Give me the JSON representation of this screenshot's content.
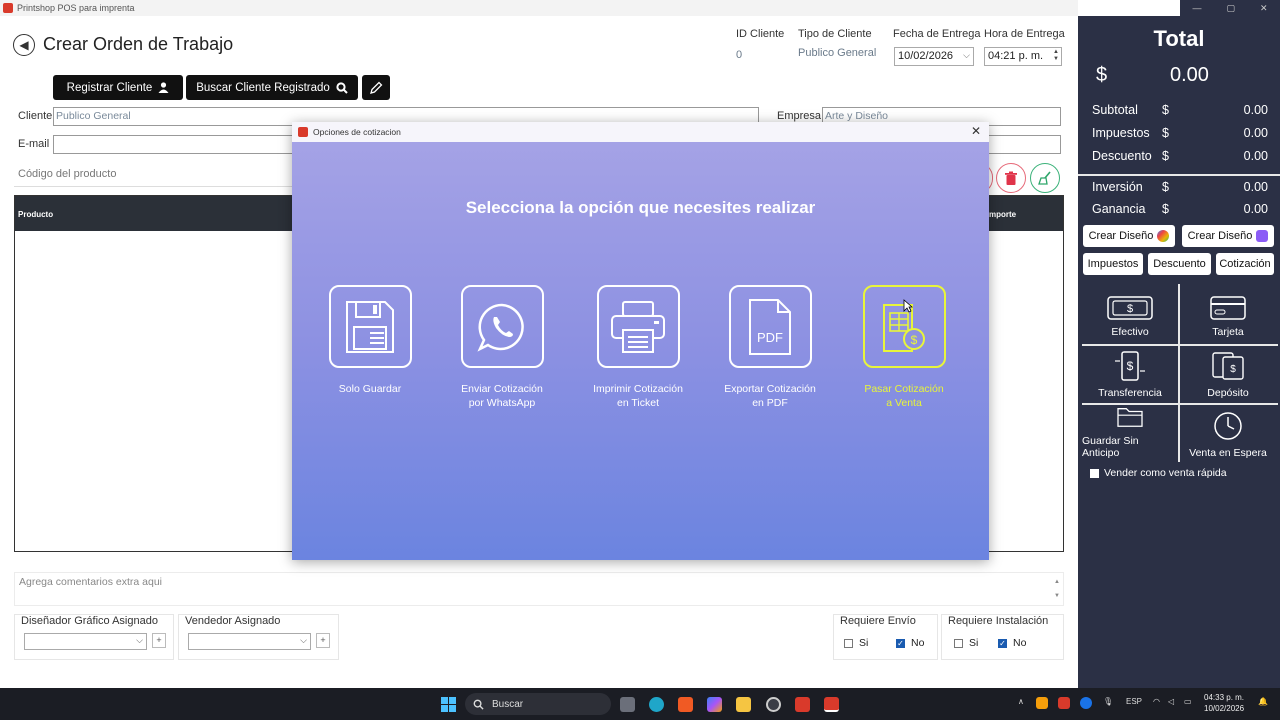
{
  "window": {
    "title": "Printshop POS para imprenta"
  },
  "page": {
    "title": "Crear Orden de Trabajo"
  },
  "header": {
    "id_label": "ID Cliente",
    "id_value": "0",
    "tipo_label": "Tipo de Cliente",
    "tipo_value": "Publico General",
    "fecha_label": "Fecha de Entrega",
    "fecha_value": "10/02/2026",
    "hora_label": "Hora  de Entrega",
    "hora_value": "04:21 p. m."
  },
  "buttons": {
    "registrar": "Registrar Cliente",
    "buscar": "Buscar Cliente Registrado"
  },
  "form": {
    "cliente_label": "Cliente",
    "cliente_value": "Publico General",
    "empresa_label": "Empresa",
    "empresa_value": "Arte y Diseño",
    "email_label": "E-mail",
    "codigo_placeholder": "Código del producto"
  },
  "table": {
    "col_producto": "Producto",
    "col_importe": "mporte"
  },
  "comments_placeholder": "Agrega comentarios extra aqui",
  "bottom": {
    "disenador_label": "Diseñador Gráfico Asignado",
    "vendedor_label": "Vendedor Asignado",
    "envio_label": "Requiere Envío",
    "instalacion_label": "Requiere Instalación",
    "si": "Si",
    "no": "No"
  },
  "summary": {
    "total_title": "Total",
    "currency": "$",
    "total_amount": "0.00",
    "rows": [
      {
        "label": "Subtotal",
        "sign": "$",
        "value": "0.00"
      },
      {
        "label": "Impuestos",
        "sign": "$",
        "value": "0.00"
      },
      {
        "label": "Descuento",
        "sign": "$",
        "value": "0.00"
      },
      {
        "label": "Inversión",
        "sign": "$",
        "value": "0.00"
      },
      {
        "label": "Ganancia",
        "sign": "$",
        "value": "0.00"
      }
    ]
  },
  "side_buttons": {
    "crear_diseno_1": "Crear Diseño",
    "crear_diseno_2": "Crear Diseño",
    "impuestos": "Impuestos",
    "descuento": "Descuento",
    "cotizacion": "Cotización"
  },
  "payments": {
    "efectivo": "Efectivo",
    "tarjeta": "Tarjeta",
    "transferencia": "Transferencia",
    "deposito": "Depósito",
    "guardar": "Guardar Sin Anticipo",
    "espera": "Venta en Espera"
  },
  "fast_sale": "Vender como venta rápida",
  "modal": {
    "title": "Opciones de cotizacion",
    "heading": "Selecciona la opción que necesites realizar",
    "options": [
      {
        "line1": "Solo Guardar",
        "line2": ""
      },
      {
        "line1": "Enviar Cotización",
        "line2": "por WhatsApp"
      },
      {
        "line1": "Imprimir Cotización",
        "line2": "en Ticket"
      },
      {
        "line1": "Exportar Cotización",
        "line2": "en PDF"
      },
      {
        "line1": "Pasar Cotización",
        "line2": "a Venta"
      }
    ],
    "pdf_text": "PDF"
  },
  "taskbar": {
    "search": "Buscar",
    "lang": "ESP",
    "time": "04:33 p. m.",
    "date": "10/02/2026"
  },
  "colors": {
    "panel": "#2b3045",
    "highlight": "#e8f53a",
    "modal_top": "#a7a4e6",
    "modal_bottom": "#6b84e0"
  }
}
